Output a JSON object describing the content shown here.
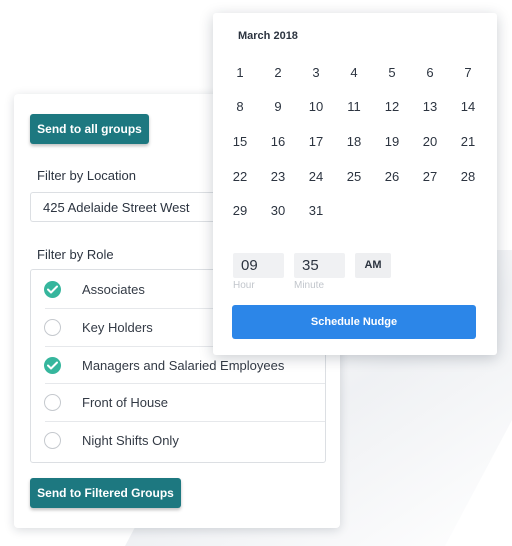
{
  "actions": {
    "send_all_label": "Send to all groups",
    "send_filtered_label": "Send to Filtered Groups"
  },
  "location": {
    "label": "Filter by Location",
    "value": "425 Adelaide Street West"
  },
  "roles": {
    "label": "Filter by Role",
    "items": [
      {
        "label": "Associates",
        "checked": true
      },
      {
        "label": "Key Holders",
        "checked": false
      },
      {
        "label": "Managers and Salaried Employees",
        "checked": true
      },
      {
        "label": "Front of House",
        "checked": false
      },
      {
        "label": "Night Shifts Only",
        "checked": false
      }
    ]
  },
  "calendar": {
    "month_title": "March 2018",
    "weeks": [
      [
        "1",
        "2",
        "3",
        "4",
        "5",
        "6",
        "7"
      ],
      [
        "8",
        "9",
        "10",
        "11",
        "12",
        "13",
        "14"
      ],
      [
        "15",
        "16",
        "17",
        "18",
        "19",
        "20",
        "21"
      ],
      [
        "22",
        "23",
        "24",
        "25",
        "26",
        "27",
        "28"
      ],
      [
        "29",
        "30",
        "31"
      ]
    ]
  },
  "time": {
    "hour": "09",
    "minute": "35",
    "ampm": "AM",
    "hour_caption": "Hour",
    "minute_caption": "Minute"
  },
  "schedule": {
    "button_label": "Schedule Nudge"
  },
  "colors": {
    "teal_button": "#1d7880",
    "check_green": "#36b69d",
    "primary_blue": "#2c86e8"
  },
  "icons": {
    "checked_radio": "check-circle-icon",
    "unchecked_radio": "empty-circle-icon"
  }
}
